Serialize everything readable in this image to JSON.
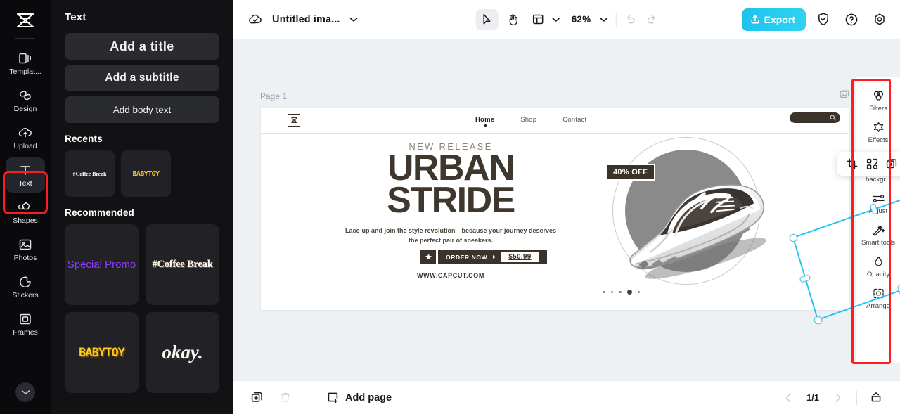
{
  "app": {
    "logo_icon": "capcut-logo-icon"
  },
  "left_rail": {
    "items": [
      {
        "label": "Templat...",
        "icon": "templates-icon",
        "active": false
      },
      {
        "label": "Design",
        "icon": "design-icon",
        "active": false
      },
      {
        "label": "Upload",
        "icon": "upload-cloud-icon",
        "active": false
      },
      {
        "label": "Text",
        "icon": "text-t-icon",
        "active": true
      },
      {
        "label": "Shapes",
        "icon": "shapes-icon",
        "active": false
      },
      {
        "label": "Photos",
        "icon": "photos-image-icon",
        "active": false
      },
      {
        "label": "Stickers",
        "icon": "stickers-icon",
        "active": false
      },
      {
        "label": "Frames",
        "icon": "frames-icon",
        "active": false
      }
    ],
    "collapse_icon": "chevron-down-icon",
    "highlight_color": "#ff1c1c",
    "highlighted_item": "Text"
  },
  "panel": {
    "title": "Text",
    "add_title": "Add a title",
    "add_subtitle": "Add a subtitle",
    "add_body": "Add body text",
    "recents_title": "Recents",
    "recents": [
      {
        "label": "#Coffee Break",
        "style": "coffee"
      },
      {
        "label": "BABYTOY",
        "style": "baby"
      }
    ],
    "recommended_title": "Recommended",
    "recommended": [
      {
        "label": "Special Promo",
        "style": "promo"
      },
      {
        "label": "#Coffee Break",
        "style": "coffee2"
      },
      {
        "label": "BABYTOY",
        "style": "baby2"
      },
      {
        "label": "okay.",
        "style": "okay"
      }
    ],
    "collapse_icon": "chevron-left-icon"
  },
  "topbar": {
    "cloud_icon": "cloud-saved-icon",
    "doc_name": "Untitled ima...",
    "doc_chevron_icon": "chevron-down-icon",
    "tools": [
      {
        "name": "select-tool",
        "icon": "cursor-arrow-icon",
        "selected": true
      },
      {
        "name": "hand-tool",
        "icon": "hand-icon",
        "selected": false
      },
      {
        "name": "layout-tool",
        "icon": "layout-grid-icon",
        "selected": false
      }
    ],
    "layout_chevron_icon": "chevron-down-icon",
    "zoom_level": "62%",
    "zoom_chevron_icon": "chevron-down-icon",
    "undo_icon": "undo-icon",
    "redo_icon": "redo-icon",
    "export_label": "Export",
    "export_icon": "export-upload-icon",
    "export_color": "#22c9ef",
    "shield_icon": "shield-check-icon",
    "help_icon": "help-question-icon",
    "settings_icon": "gear-icon"
  },
  "canvas": {
    "page_label": "Page 1",
    "duplicate_page_icon": "duplicate-page-icon",
    "mini_toolbar": [
      {
        "name": "crop-button",
        "icon": "crop-icon"
      },
      {
        "name": "replace-button",
        "icon": "replace-swap-icon"
      },
      {
        "name": "duplicate-button",
        "icon": "duplicate-icon"
      },
      {
        "name": "more-options-button",
        "icon": "ellipsis-icon"
      }
    ],
    "selection": {
      "rotate_icon": "rotate-handle-icon",
      "handle_color": "#59c4e6"
    }
  },
  "design": {
    "logo_icon": "brand-mark-icon",
    "nav": [
      {
        "label": "Home",
        "active": true
      },
      {
        "label": "Shop",
        "active": false
      },
      {
        "label": "Contact",
        "active": false
      }
    ],
    "search_icon": "search-icon",
    "eyebrow": "NEW RELEASE",
    "headline_line1": "URBAN",
    "headline_line2": "STRIDE",
    "subtext": "Lace-up and join the style revolution—because your journey deserves the perfect pair of sneakers.",
    "star_icon": "star-icon",
    "cta_label": "ORDER NOW",
    "cta_arrow_icon": "play-arrow-icon",
    "price": "$50.99",
    "website": "WWW.CAPCUT.COM",
    "badge": "40% OFF",
    "carousel_dots": 5,
    "carousel_active_index": 3
  },
  "right_rail": {
    "items": [
      {
        "label": "Filters",
        "icon": "filters-circles-icon"
      },
      {
        "label": "Effects",
        "icon": "effects-star-icon"
      },
      {
        "label": "Remove backgr...",
        "icon": "remove-background-icon"
      },
      {
        "label": "Adjust",
        "icon": "adjust-sliders-icon"
      },
      {
        "label": "Smart tools",
        "icon": "smart-tools-wand-icon"
      },
      {
        "label": "Opacity",
        "icon": "opacity-drop-icon"
      },
      {
        "label": "Arrange",
        "icon": "arrange-icon"
      }
    ],
    "highlight_color": "#ff1c1c"
  },
  "bottombar": {
    "duplicate_icon": "duplicate-page-icon",
    "delete_icon": "trash-icon",
    "add_page_label": "Add page",
    "add_page_icon": "add-page-icon",
    "prev_icon": "chevron-left-icon",
    "page_indicator": "1/1",
    "next_icon": "chevron-right-icon",
    "grid_view_icon": "pages-panel-icon"
  }
}
